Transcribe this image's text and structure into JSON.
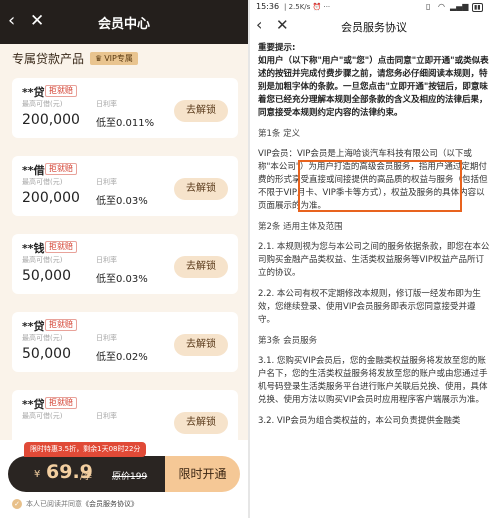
{
  "left": {
    "header": {
      "back_glyph": "‹",
      "close_glyph": "✕",
      "title": "会员中心"
    },
    "section": {
      "title": "专属贷款产品",
      "vip_badge": "VIP专属"
    },
    "cards": [
      {
        "name": "**贷",
        "tag": "拒就赔",
        "amount_label": "最高可借(元)",
        "rate_label": "日利率",
        "amount": "200,000",
        "rate": "低至0.011%",
        "button": "去解锁"
      },
      {
        "name": "**借",
        "tag": "拒就赔",
        "amount_label": "最高可借(元)",
        "rate_label": "日利率",
        "amount": "200,000",
        "rate": "低至0.03%",
        "button": "去解锁"
      },
      {
        "name": "**钱",
        "tag": "拒就赔",
        "amount_label": "最高可借(元)",
        "rate_label": "日利率",
        "amount": "50,000",
        "rate": "低至0.03%",
        "button": "去解锁"
      },
      {
        "name": "**贷",
        "tag": "拒就赔",
        "amount_label": "最高可借(元)",
        "rate_label": "日利率",
        "amount": "50,000",
        "rate": "低至0.02%",
        "button": "去解锁"
      },
      {
        "name": "**贷",
        "tag": "拒就赔",
        "amount_label": "最高可借(元)",
        "rate_label": "日利率",
        "amount": "",
        "rate": "",
        "button": "去解锁"
      }
    ],
    "footer": {
      "promo": "限时特惠3.5折，剩余1天08时22分",
      "price_symbol": "¥",
      "price": "69.9",
      "price_unit": "/季",
      "original_price": "原价199",
      "open_button": "限时开通",
      "agree_prefix": "本人已阅读并同意",
      "agree_link": "《会员服务协议》"
    }
  },
  "right": {
    "status": {
      "time": "15:36",
      "meta": "| 2.5K/s ⏰ ···"
    },
    "header": {
      "back_glyph": "‹",
      "close_glyph": "✕",
      "title": "会员服务协议"
    },
    "doc": {
      "imp_head": "重要提示:",
      "imp_body": "如用户（以下称\"用户\"或\"您\"）点击同意\"立即开通\"或类似表述的按钮并完成付费步骤之前，请您务必仔细阅读本规则，特别是加粗字体的条款。一旦您点击\"立即开通\"按钮后，即意味着您已经充分理解本规则全部条款的含义及相应的法律后果，同意接受本规则约定内容的法律约束。",
      "art1": "第1条 定义",
      "art1_body": "VIP会员：VIP会员是上海哈谈汽车科技有限公司（以下或称\"本公司\"）为用户打造的高级会员服务，指用户通过定期付费的形式享受直接或间接提供的高品质的权益与服务（包括但不限于VIP月卡、VIP季卡等方式），权益及服务的具体内容以页面展示的为准。",
      "art2": "第2条 适用主体及范围",
      "p21": "2.1. 本规则视为您与本公司之间的服务依据条款，即您在本公司购买金融产品类权益、生活类权益服务等VIP权益产品所订立的协议。",
      "p22": "2.2. 本公司有权不定期修改本规则，修订版一经发布即为生效，您继续登录、使用VIP会员服务即表示您同意接受并遵守。",
      "art3": "第3条 会员服务",
      "p31": "3.1. 您购买VIP会员后，您的金融类权益服务将发放至您的账户名下，您的生活类权益服务将发放至您的账户或由您通过手机号码登录生活类服务平台进行账户关联后兑换、使用，具体兑换、使用方法以购买VIP会员时应用程序客户端展示为准。",
      "p32": "3.2. VIP会员为组合类权益的，本公司负责提供金融类"
    }
  }
}
